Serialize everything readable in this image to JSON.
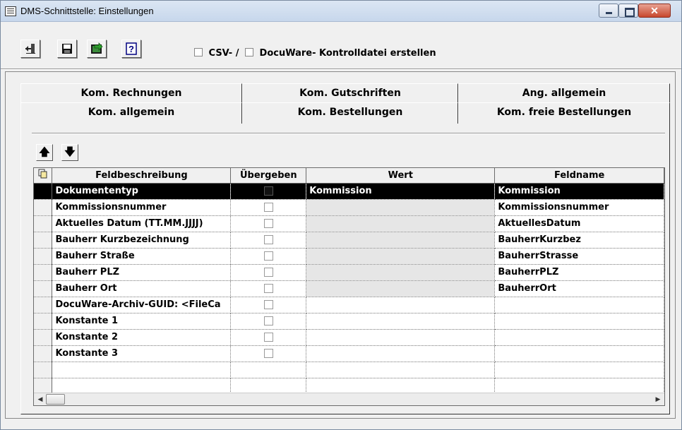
{
  "window": {
    "title": "DMS-Schnittstelle: Einstellungen"
  },
  "toolbar": {
    "buttons": [
      "exit-icon",
      "save-icon",
      "export-icon",
      "help-icon"
    ],
    "help_label": "?",
    "csv_label": "CSV- /",
    "docuware_label": "DocuWare- Kontrolldatei erstellen"
  },
  "tabs": {
    "row1": [
      "Kom. Rechnungen",
      "Kom. Gutschriften",
      "Ang. allgemein"
    ],
    "row2": [
      "Kom. allgemein",
      "Kom. Bestellungen",
      "Kom. freie Bestellungen"
    ],
    "active": "Kom. allgemein"
  },
  "grid": {
    "headers": {
      "feldbeschreibung": "Feldbeschreibung",
      "uebergeben": "Übergeben",
      "wert": "Wert",
      "feldname": "Feldname"
    },
    "rows": [
      {
        "feldbeschreibung": "Dokumententyp",
        "wert": "Kommission",
        "feldname": "Kommission",
        "selected": true
      },
      {
        "feldbeschreibung": "Kommissionsnummer",
        "wert": "",
        "feldname": "Kommissionsnummer"
      },
      {
        "feldbeschreibung": "Aktuelles Datum (TT.MM.JJJJ)",
        "wert": "",
        "feldname": "AktuellesDatum"
      },
      {
        "feldbeschreibung": "Bauherr Kurzbezeichnung",
        "wert": "",
        "feldname": "BauherrKurzbez"
      },
      {
        "feldbeschreibung": "Bauherr Straße",
        "wert": "",
        "feldname": "BauherrStrasse"
      },
      {
        "feldbeschreibung": "Bauherr PLZ",
        "wert": "",
        "feldname": "BauherrPLZ"
      },
      {
        "feldbeschreibung": "Bauherr Ort",
        "wert": "",
        "feldname": "BauherrOrt"
      },
      {
        "feldbeschreibung": "DocuWare-Archiv-GUID: <FileCa",
        "wert": "",
        "feldname": ""
      },
      {
        "feldbeschreibung": "Konstante 1",
        "wert": "",
        "feldname": ""
      },
      {
        "feldbeschreibung": "Konstante 2",
        "wert": "",
        "feldname": ""
      },
      {
        "feldbeschreibung": "Konstante 3",
        "wert": "",
        "feldname": ""
      }
    ]
  },
  "arrows": {
    "up": "🡅",
    "down": "🡇"
  }
}
